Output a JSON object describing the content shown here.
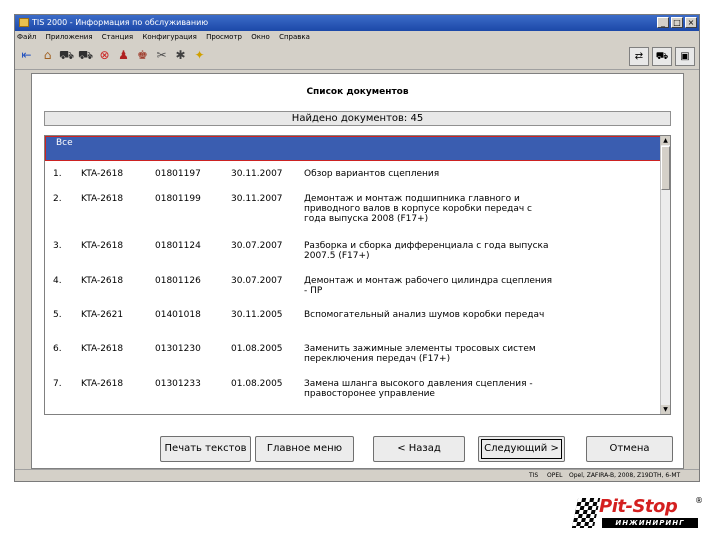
{
  "window": {
    "title": "TIS 2000 - Информация по обслуживанию",
    "min_label": "_",
    "max_label": "□",
    "close_label": "×"
  },
  "menu": [
    "Файл",
    "Приложения",
    "Станция",
    "Конфигурация",
    "Просмотр",
    "Окно",
    "Справка"
  ],
  "panel": {
    "title": "Список документов",
    "found": "Найдено документов: 45"
  },
  "list": {
    "header": "Все",
    "rows": [
      {
        "num": "1.",
        "code": "KTA-2618",
        "doc": "01801197",
        "date": "30.11.2007",
        "text": "Обзор вариантов сцепления"
      },
      {
        "num": "2.",
        "code": "KTA-2618",
        "doc": "01801199",
        "date": "30.11.2007",
        "text": "Демонтаж и монтаж подшипника главного и приводного валов в корпусе коробки передач с года выпуска 2008 (F17+)"
      },
      {
        "num": "3.",
        "code": "KTA-2618",
        "doc": "01801124",
        "date": "30.07.2007",
        "text": "Разборка и сборка дифференциала с года выпуска 2007.5 (F17+)"
      },
      {
        "num": "4.",
        "code": "KTA-2618",
        "doc": "01801126",
        "date": "30.07.2007",
        "text": "Демонтаж и монтаж рабочего цилиндра сцепления - ПР"
      },
      {
        "num": "5.",
        "code": "KTA-2621",
        "doc": "01401018",
        "date": "30.11.2005",
        "text": "Вспомогательный анализ шумов коробки передач"
      },
      {
        "num": "6.",
        "code": "KTA-2618",
        "doc": "01301230",
        "date": "01.08.2005",
        "text": "Заменить зажимные элементы тросовых систем переключения передач (F17+)"
      },
      {
        "num": "7.",
        "code": "KTA-2618",
        "doc": "01301233",
        "date": "01.08.2005",
        "text": "Замена шланга высокого давления сцепления - правосторонее управление"
      }
    ]
  },
  "buttons": {
    "print": "Печать текстов",
    "main_menu": "Главное меню",
    "back": "< Назад",
    "next": "Следующий >",
    "cancel": "Отмена"
  },
  "status": {
    "tis": "TIS",
    "make": "OPEL",
    "vehicle": "Opel, ZAFIRA-B, 2008, Z19DTH, 6-МТ"
  },
  "logo": {
    "brand": "Pit-Stop",
    "sub": "ИНЖИНИРИНГ",
    "reg": "®"
  }
}
